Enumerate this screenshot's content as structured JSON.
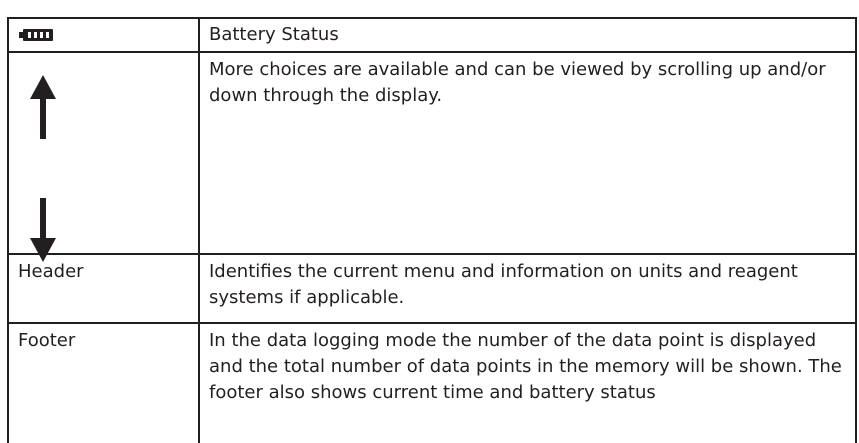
{
  "table": {
    "rows": [
      {
        "icon": "battery-icon",
        "description": "Battery Status"
      },
      {
        "icon": "scroll-arrows-icon",
        "description": "More choices are available and can be viewed by scrolling up and/or down through the display."
      },
      {
        "term": "Header",
        "description": "Identifies the current menu and information on units and reagent systems if applicable."
      },
      {
        "term": "Footer",
        "description": "In the data logging mode the number of the data point is displayed and the total number of data points in the memory will be shown. The footer also shows current time and battery status"
      }
    ]
  },
  "colors": {
    "text": "#231f20",
    "border": "#231f20",
    "background": "#ffffff"
  }
}
